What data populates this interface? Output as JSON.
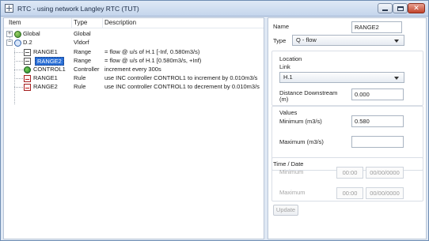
{
  "window": {
    "title": "RTC - using network Langley RTC (TUT)"
  },
  "tree": {
    "columns": [
      "Item",
      "Type",
      "Description"
    ],
    "rows": [
      {
        "item": "Global",
        "type": "Global",
        "description": "",
        "icon": "globe-icon",
        "expander": "+"
      },
      {
        "item": "D.2",
        "type": "Vldorf",
        "description": "",
        "icon": "network-icon",
        "expander": "−"
      },
      {
        "item": "RANGE1",
        "type": "Range",
        "description": "= flow @ u/s of H.1 [-Inf, 0.580m3/s)",
        "icon": "range-icon"
      },
      {
        "item": "RANGE2",
        "type": "Range",
        "description": "= flow @ u/s of H.1 [0.580m3/s, +Inf)",
        "icon": "range-icon",
        "selected": true
      },
      {
        "item": "CONTROL1",
        "type": "Controller",
        "description": "increment every 300s",
        "icon": "controller-icon"
      },
      {
        "item": "RANGE1",
        "type": "Rule",
        "description": "use INC controller CONTROL1 to increment by 0.010m3/s",
        "icon": "rule-icon"
      },
      {
        "item": "RANGE2",
        "type": "Rule",
        "description": "use INC controller CONTROL1 to decrement by 0.010m3/s",
        "icon": "rule-icon"
      }
    ]
  },
  "props": {
    "name_label": "Name",
    "name_value": "RANGE2",
    "type_label": "Type",
    "type_value": "Q - flow",
    "location_label": "Location",
    "link_label": "Link",
    "link_value": "H.1",
    "distance_label_line1": "Distance Downstream",
    "distance_label_line2": "(m)",
    "distance_value": "0.000",
    "values_label": "Values",
    "minimum_label": "Minimum (m3/s)",
    "minimum_value": "0.580",
    "maximum_label": "Maximum (m3/s)",
    "maximum_value": "",
    "time_date_label": "Time / Date",
    "td_minimum_label": "Minimum",
    "td_minimum_time": "00:00",
    "td_minimum_date": "00/00/0000",
    "td_maximum_label": "Maximum",
    "td_maximum_time": "00:00",
    "td_maximum_date": "00/00/0000",
    "update_label": "Update"
  }
}
